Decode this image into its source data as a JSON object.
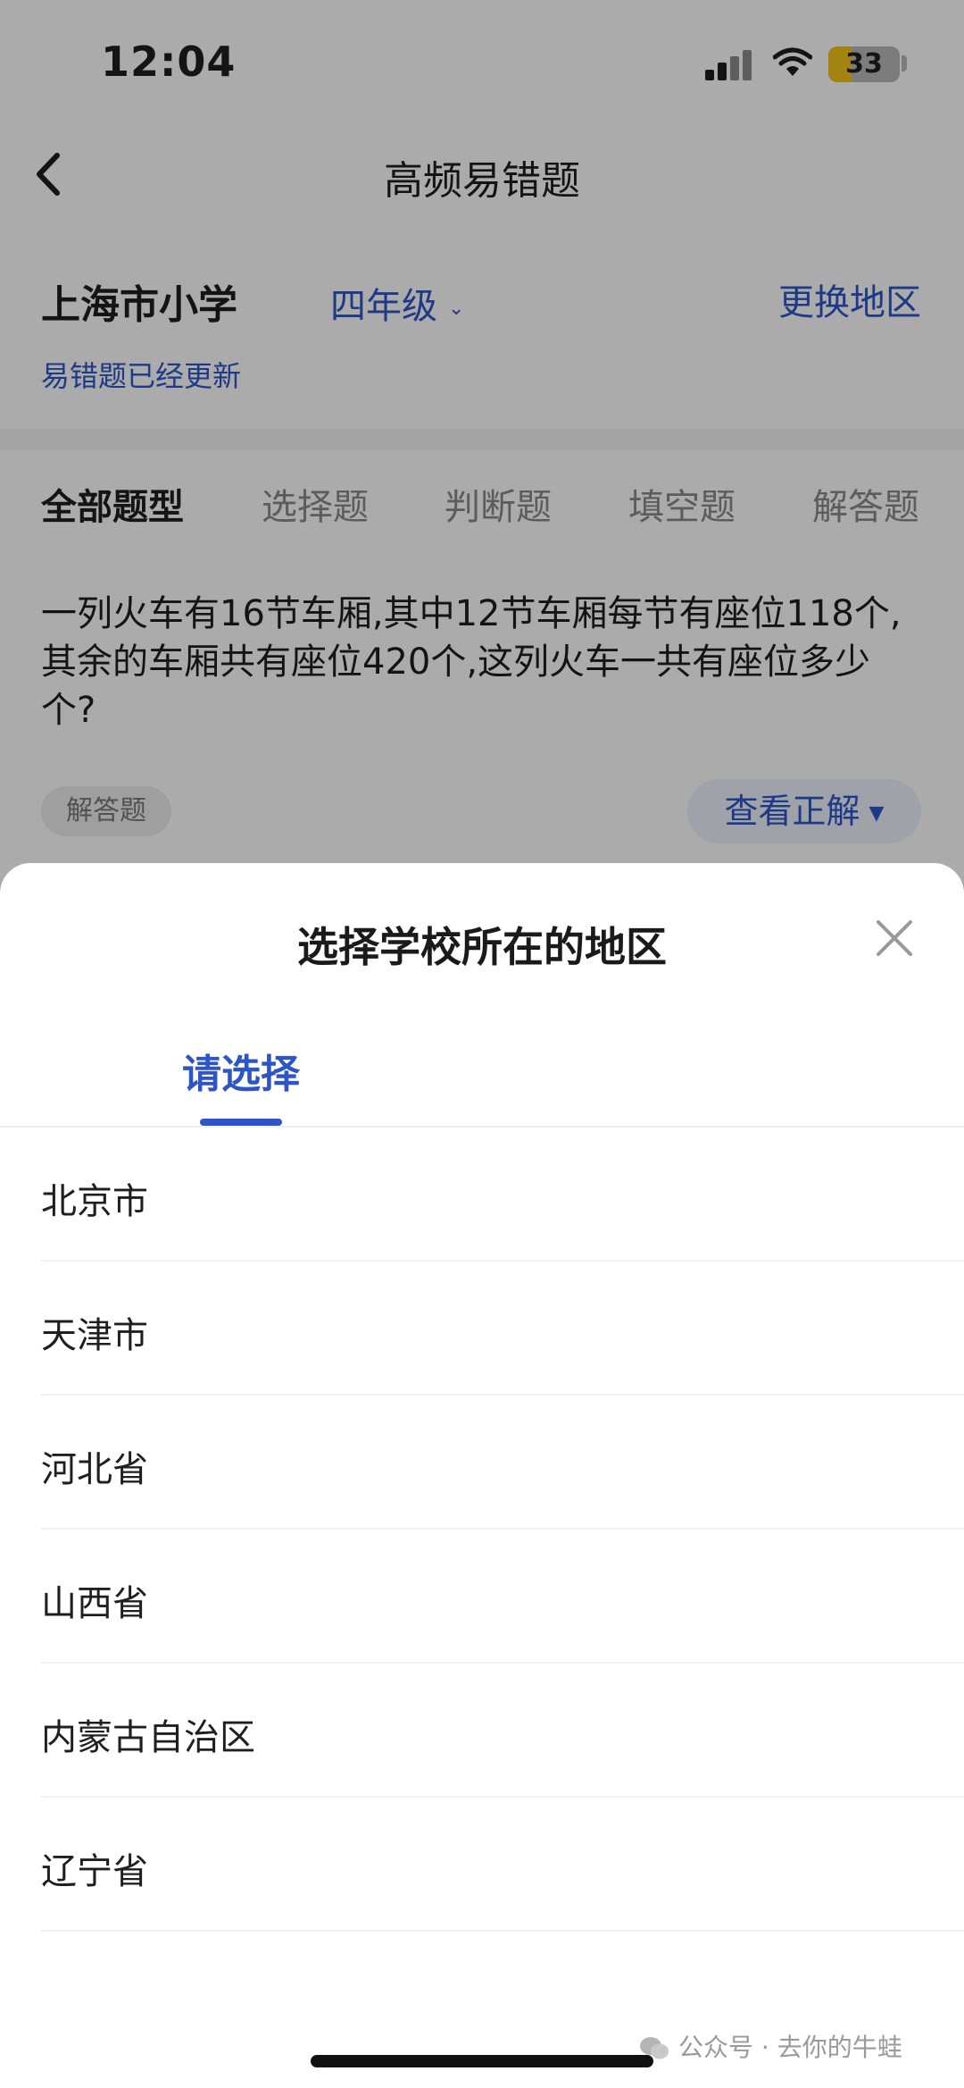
{
  "status_bar": {
    "time": "12:04",
    "battery": "33",
    "battery_level": 0.33
  },
  "header": {
    "title": "高频易错题"
  },
  "filters": {
    "school": "上海市小学",
    "grade": "四年级",
    "change_region": "更换地区",
    "updated_note": "易错题已经更新"
  },
  "tabs": [
    {
      "label": "全部题型",
      "active": true
    },
    {
      "label": "选择题",
      "active": false
    },
    {
      "label": "判断题",
      "active": false
    },
    {
      "label": "填空题",
      "active": false
    },
    {
      "label": "解答题",
      "active": false
    }
  ],
  "question": {
    "text": "一列火车有16节车厢,其中12节车厢每节有座位118个,其余的车厢共有座位420个,这列火车一共有座位多少个?",
    "type_badge": "解答题",
    "view_answer": "查看正解"
  },
  "sheet": {
    "title": "选择学校所在的地区",
    "tab_label": "请选择",
    "regions": [
      "北京市",
      "天津市",
      "河北省",
      "山西省",
      "内蒙古自治区",
      "辽宁省"
    ]
  },
  "watermark": "公众号 · 去你的牛蛙",
  "colors": {
    "accent": "#2d55c8",
    "battery": "#f5c518"
  }
}
